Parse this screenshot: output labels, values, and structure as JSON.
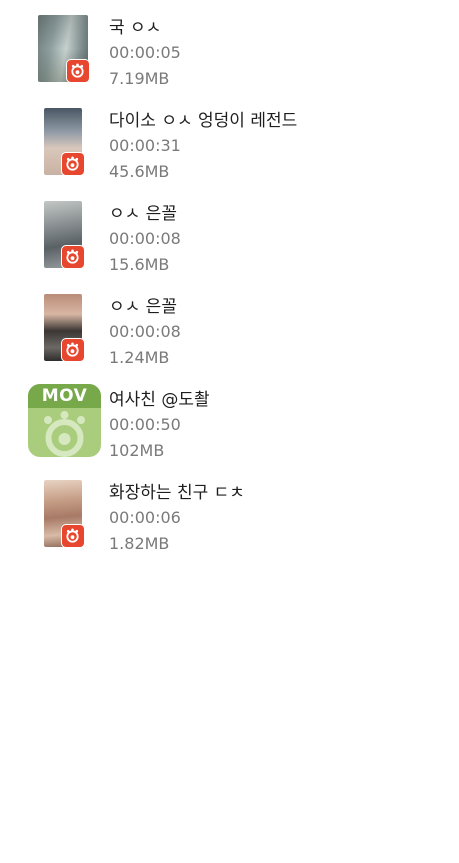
{
  "files": [
    {
      "title": "국 ㅇㅅ",
      "duration": "00:00:05",
      "size": "7.19MB",
      "icon": "gom-player-badge-icon"
    },
    {
      "title": "다이소 ㅇㅅ 엉덩이 레전드",
      "duration": "00:00:31",
      "size": "45.6MB",
      "icon": "gom-player-badge-icon"
    },
    {
      "title": "ㅇㅅ 은꼴",
      "duration": "00:00:08",
      "size": "15.6MB",
      "icon": "gom-player-badge-icon"
    },
    {
      "title": "ㅇㅅ 은꼴",
      "duration": "00:00:08",
      "size": "1.24MB",
      "icon": "gom-player-badge-icon"
    },
    {
      "title": "여사친 @도촬",
      "duration": "00:00:50",
      "size": "102MB",
      "icon": "mov-file-icon",
      "type_label": "MOV"
    },
    {
      "title": "화장하는 친구 ㄷㅊ",
      "duration": "00:00:06",
      "size": "1.82MB",
      "icon": "gom-player-badge-icon"
    }
  ],
  "colors": {
    "badge": "#e8472f",
    "mov_band": "#77a94a",
    "mov_body": "#a9cd7c",
    "title_text": "#1e1e1e",
    "meta_text": "#7a7a7a"
  }
}
